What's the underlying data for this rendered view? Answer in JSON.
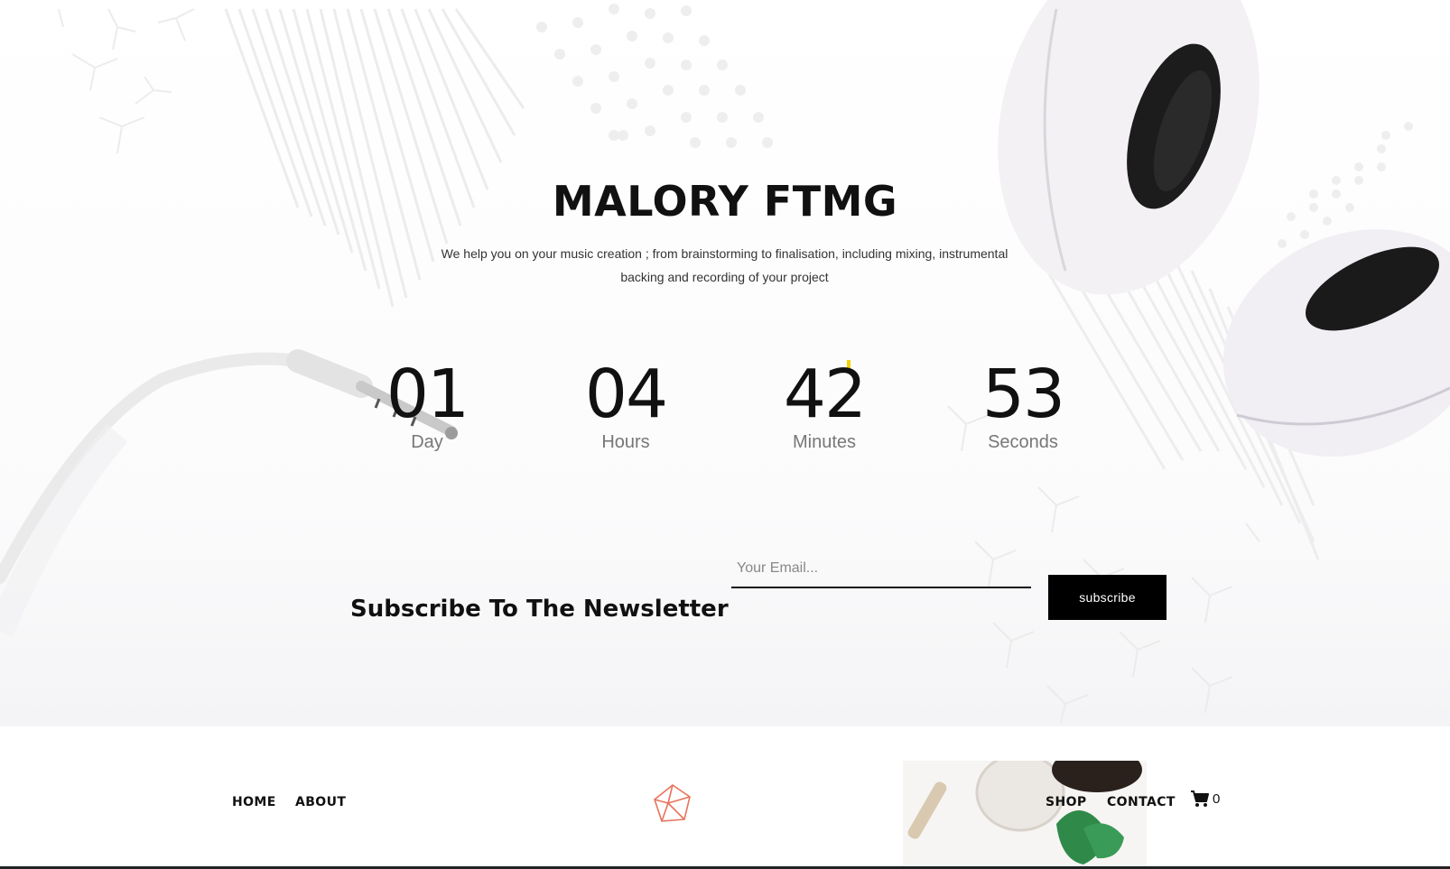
{
  "hero": {
    "title": "MALORY FTMG",
    "tagline": "We help you on your music creation ; from brainstorming to finalisation, including mixing, instrumental backing and recording of your project"
  },
  "countdown": [
    {
      "value": "01",
      "label": "Day"
    },
    {
      "value": "04",
      "label": "Hours"
    },
    {
      "value": "42",
      "label": "Minutes"
    },
    {
      "value": "53",
      "label": "Seconds"
    }
  ],
  "newsletter": {
    "title": "Subscribe To The Newsletter",
    "email_placeholder": "Your Email...",
    "button_label": "subscribe"
  },
  "nav": {
    "home": "HOME",
    "about": "ABOUT",
    "shop": "SHOP",
    "contact": "CONTACT",
    "cart_count": "0"
  },
  "colors": {
    "logo": "#e8735a",
    "button_bg": "#000000",
    "accent_mark": "#f2d200"
  },
  "icons": {
    "logo": "geometric-diamond-logo-icon",
    "cart": "shopping-cart-icon"
  }
}
